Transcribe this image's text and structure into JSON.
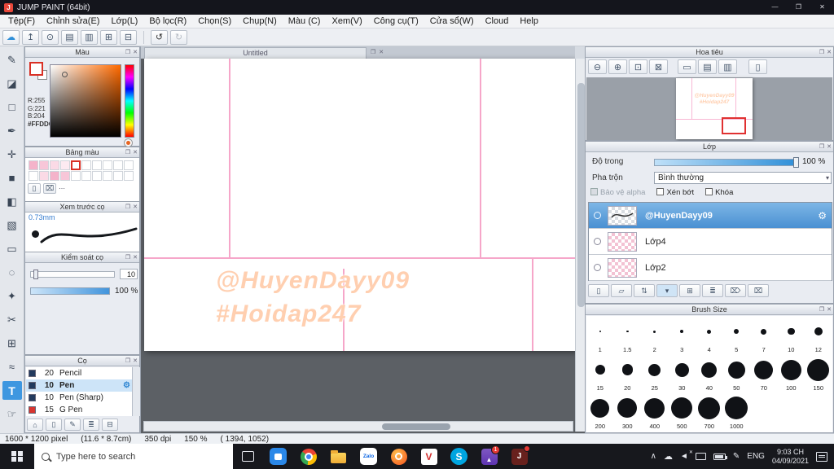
{
  "colors": {
    "accent": "#3e97e0",
    "selected_layer": "#5aa5e2",
    "guide_pink": "#f6a6c9",
    "watermark_peach": "#ffcfb0",
    "canvas_bg": "#5c6065",
    "title_bg": "#14151c",
    "taskbar_bg": "#17181d"
  },
  "icons": {
    "float": "❐",
    "close": "✕",
    "gear": "⚙",
    "dropdown": "▾",
    "ellipsis": "⋯"
  },
  "titlebar": {
    "app_letter": "J",
    "title": "JUMP PAINT (64bit)",
    "minimize": "—",
    "maximize": "❐",
    "close": "✕"
  },
  "menubar": {
    "items": [
      "Tệp(F)",
      "Chỉnh sửa(E)",
      "Lớp(L)",
      "Bộ lọc(R)",
      "Chọn(S)",
      "Chụp(N)",
      "Màu (C)",
      "Xem(V)",
      "Công cụ(T)",
      "Cửa sổ(W)",
      "Cloud",
      "Help"
    ]
  },
  "toolbar": {
    "cloud": "☁",
    "upload": "↥",
    "comment": "⊙",
    "panels": "▤",
    "pages": "▥",
    "grid": "⊞",
    "tiles": "⊟",
    "undo": "↺",
    "redo": "↻"
  },
  "tools": [
    {
      "name": "pen-tool",
      "glyph": "✎"
    },
    {
      "name": "eraser-tool",
      "glyph": "◪"
    },
    {
      "name": "shape-brush-tool",
      "glyph": "□"
    },
    {
      "name": "nib-tool",
      "glyph": "✒"
    },
    {
      "name": "move-tool",
      "glyph": "✛"
    },
    {
      "name": "fill-rect-tool",
      "glyph": "■"
    },
    {
      "name": "bucket-tool",
      "glyph": "◧"
    },
    {
      "name": "gradient-tool",
      "glyph": "▧"
    },
    {
      "name": "marquee-tool",
      "glyph": "▭"
    },
    {
      "name": "lasso-tool",
      "glyph": "◌"
    },
    {
      "name": "wand-tool",
      "glyph": "✦"
    },
    {
      "name": "panel-cut-tool",
      "glyph": "✂"
    },
    {
      "name": "frame-tool",
      "glyph": "⊞"
    },
    {
      "name": "curve-tool",
      "glyph": "≈"
    },
    {
      "name": "text-tool",
      "glyph": "T"
    },
    {
      "name": "hand-tool",
      "glyph": "☞"
    }
  ],
  "color_panel": {
    "title": "Màu",
    "r": "R:255",
    "g": "G:221",
    "b": "B:204",
    "hex": "#FFDDCC"
  },
  "palette_panel": {
    "title": "Bảng màu",
    "swatches": [
      "#f4b3ca",
      "#f7c6d8",
      "#fbdae6",
      "#fdeaf1",
      "#ffffff",
      "#ffffff",
      "#ffffff",
      "#ffffff",
      "#ffffff",
      "#ffffff",
      "#ffffff",
      "#fbdae6",
      "#f4b3ca",
      "#f7c6d8",
      "#ffffff",
      "#ffffff",
      "#ffffff",
      "#ffffff",
      "#ffffff",
      "#ffffff"
    ],
    "tools": [
      "▯",
      "⌧"
    ]
  },
  "preview_panel": {
    "title": "Xem trước cọ",
    "size": "0.73mm"
  },
  "control_panel": {
    "title": "Kiểm soát cọ",
    "size_value": "10",
    "opacity_value": "100 %"
  },
  "brush_panel": {
    "title": "Cọ",
    "items": [
      {
        "chip": "#223a5e",
        "size": "20",
        "name": "Pencil"
      },
      {
        "chip": "#223a5e",
        "size": "10",
        "name": "Pen"
      },
      {
        "chip": "#223a5e",
        "size": "10",
        "name": "Pen (Sharp)"
      },
      {
        "chip": "#d8352f",
        "size": "15",
        "name": "G Pen"
      }
    ],
    "tools": [
      "⌂",
      "▯",
      "✎",
      "≣",
      "⊟"
    ]
  },
  "canvas": {
    "tab": "Untitled",
    "watermark_line1": "@HuyenDayy09",
    "watermark_line2": "#Hoidap247",
    "watermark_color": "#ffcfb0",
    "guide_color": "#f6a6c9"
  },
  "navigator": {
    "title": "Hoa tiêu",
    "buttons": [
      "⊖",
      "⊕",
      "⊡",
      "⊠",
      "▭",
      "▤",
      "▥",
      "▯"
    ]
  },
  "layers_panel": {
    "title": "Lớp",
    "opacity_label": "Độ trong",
    "opacity_value": "100 %",
    "blend_label": "Pha trộn",
    "blend_value": "Bình thường",
    "checkbox_alpha": "Bảo vệ alpha",
    "checkbox_clip": "Xén bớt",
    "checkbox_lock": "Khóa",
    "layers": [
      {
        "name": "@HuyenDayy09"
      },
      {
        "name": "Lớp4"
      },
      {
        "name": "Lớp2"
      }
    ],
    "tools": [
      "▯",
      "▱",
      "⇅",
      "▾",
      "⊞",
      "≣",
      "⌦",
      "⌧"
    ]
  },
  "brush_size_panel": {
    "title": "Brush Size",
    "sizes": [
      "1",
      "1.5",
      "2",
      "3",
      "4",
      "5",
      "7",
      "10",
      "12",
      "15",
      "20",
      "25",
      "30",
      "40",
      "50",
      "70",
      "100",
      "150",
      "200",
      "300",
      "400",
      "500",
      "700",
      "1000"
    ]
  },
  "statusbar": {
    "dimensions": "1600 * 1200 pixel",
    "physical": "(11.6 * 8.7cm)",
    "dpi": "350 dpi",
    "zoom": "150 %",
    "coords": "( 1394, 1052)"
  },
  "taskbar": {
    "search_placeholder": "Type here to search",
    "zalo_label": "Zalo",
    "v_label": "V",
    "skype_label": "S",
    "photos_glyph": "▲",
    "jump_label": "J",
    "photos_badge": "1",
    "lang": "ENG",
    "time": "9:03 CH",
    "date": "04/09/2021"
  }
}
